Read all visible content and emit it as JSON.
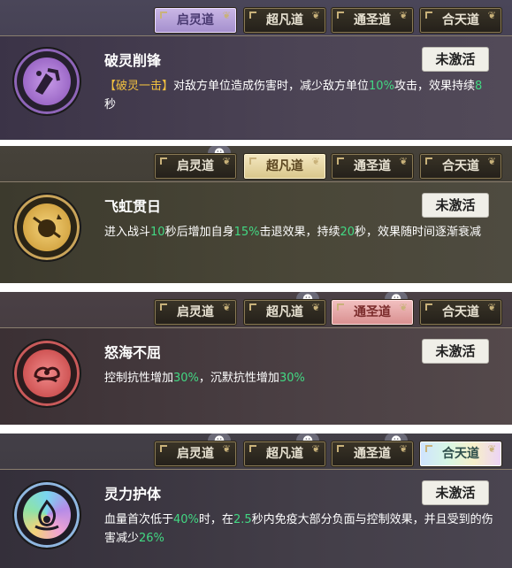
{
  "tabs": [
    "启灵道",
    "超凡道",
    "通圣道",
    "合天道"
  ],
  "button_label": "未激活",
  "sections": [
    {
      "title": "破灵削锋",
      "desc_parts": [
        "【破灵一击】",
        "对敌方单位造成伤害时，减少敌方单位",
        "10%",
        "攻击，效果持续",
        "8",
        "秒"
      ],
      "active_tab": 0,
      "theme": "purple"
    },
    {
      "title": "飞虹贯日",
      "desc_parts": [
        "进入战斗",
        "10",
        "秒后增加自身",
        "15%",
        "击退效果，持续",
        "20",
        "秒，效果随时间逐渐衰减"
      ],
      "active_tab": 1,
      "theme": "gold"
    },
    {
      "title": "怒海不屈",
      "desc_parts": [
        "控制抗性增加",
        "30%",
        "，沉默抗性增加",
        "30%"
      ],
      "active_tab": 2,
      "theme": "red"
    },
    {
      "title": "灵力护体",
      "desc_parts": [
        "血量首次低于",
        "40%",
        "时，在",
        "2.5",
        "秒内免疫大部分负面与控制效果，并且受到的伤害减少",
        "26%"
      ],
      "active_tab": 3,
      "theme": "rainbow"
    }
  ],
  "colors": {
    "highlight": "#42d883",
    "gold_text": "#f0c040"
  }
}
